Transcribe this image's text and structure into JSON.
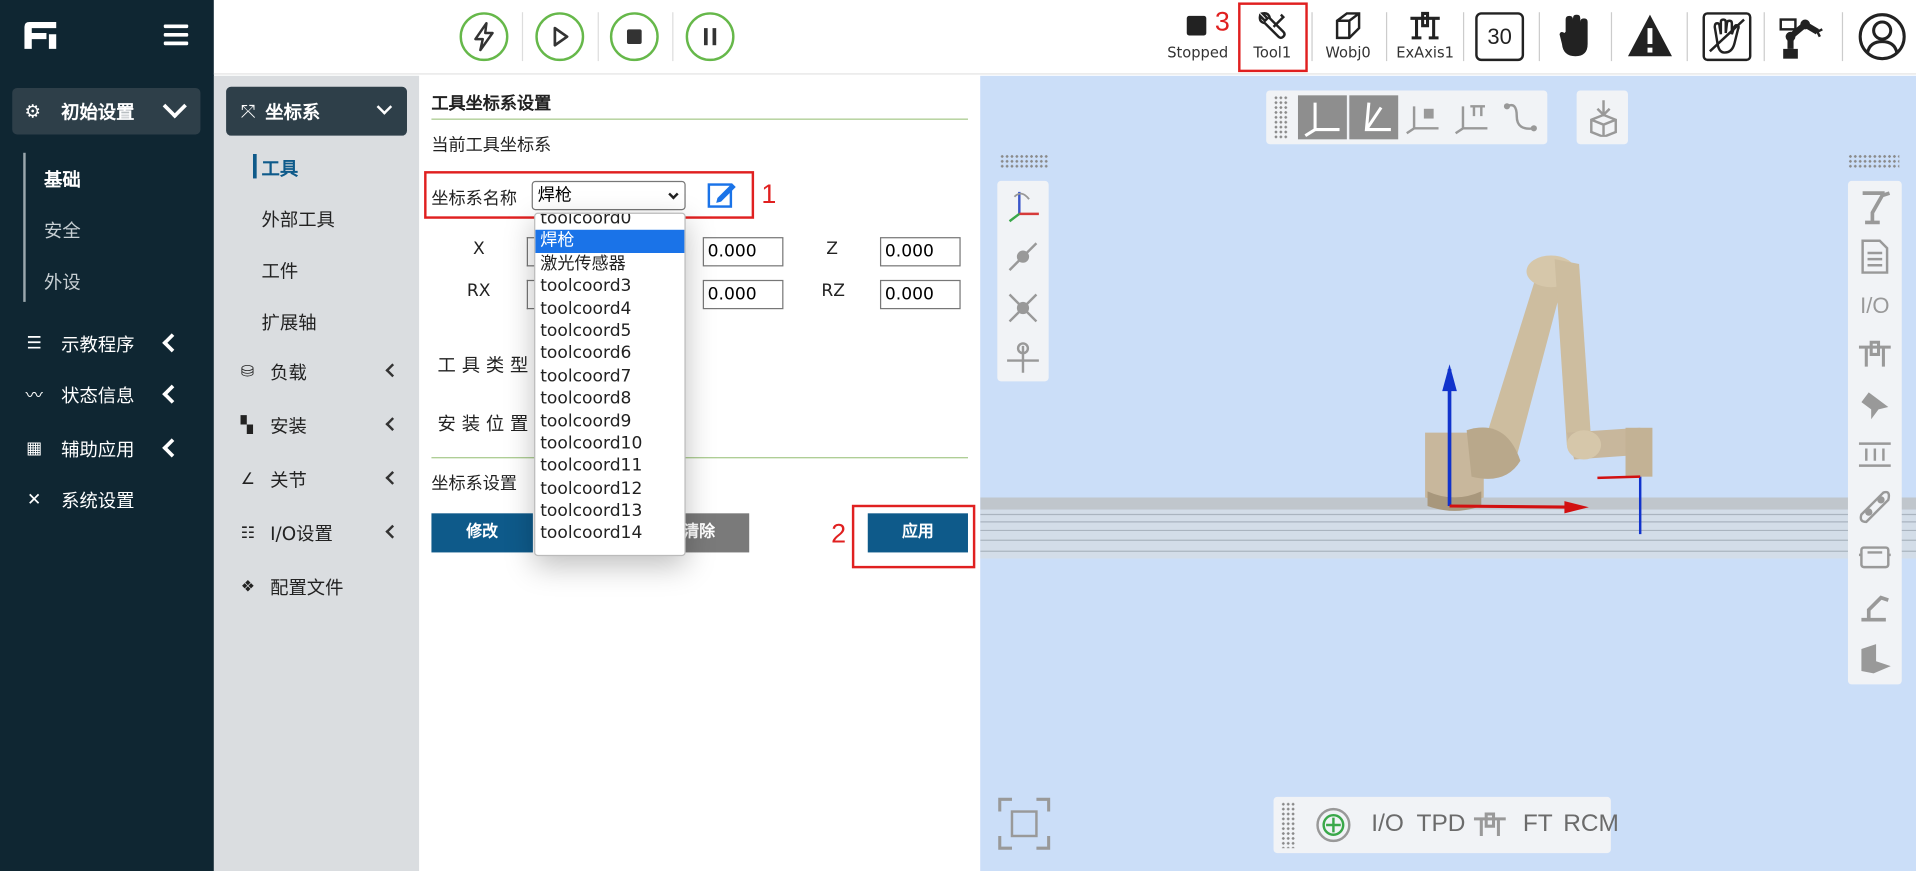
{
  "sidebar": {
    "group_label": "初始设置",
    "sub_items": [
      "基础",
      "安全",
      "外设"
    ],
    "menu": [
      {
        "label": "示教程序",
        "icon": "list-icon"
      },
      {
        "label": "状态信息",
        "icon": "pulse-icon"
      },
      {
        "label": "辅助应用",
        "icon": "grid-icon"
      },
      {
        "label": "系统设置",
        "icon": "tools-icon"
      }
    ]
  },
  "nav2": {
    "head_label": "坐标系",
    "sub_items": [
      "工具",
      "外部工具",
      "工件",
      "扩展轴"
    ],
    "items": [
      {
        "label": "负载",
        "icon": "database-icon"
      },
      {
        "label": "安装",
        "icon": "install-icon"
      },
      {
        "label": "关节",
        "icon": "angle-icon"
      },
      {
        "label": "I/O设置",
        "icon": "sliders-icon"
      },
      {
        "label": "配置文件",
        "icon": "file-icon"
      }
    ]
  },
  "topbar": {
    "status_label": "Stopped",
    "tool_label": "Tool1",
    "wobj_label": "Wobj0",
    "exaxis_label": "ExAxis1",
    "speed_value": "30"
  },
  "annotations": {
    "one": "1",
    "two": "2",
    "three": "3"
  },
  "form": {
    "title": "工具坐标系设置",
    "current_label": "当前工具坐标系",
    "name_label": "坐标系名称",
    "selected_value": "焊枪",
    "x_label": "X",
    "z_label": "Z",
    "rx_label": "RX",
    "rz_label": "RZ",
    "y_value": "0.000",
    "z_value": "0.000",
    "ry_value": "0.000",
    "rz_value": "0.000",
    "tool_type_label": "工 具 类 型",
    "install_pos_label": "安 装 位 置",
    "settings_label": "坐标系设置",
    "modify_button": "修改",
    "clear_button": "清除",
    "apply_button": "应用"
  },
  "dropdown": {
    "options": [
      "toolcoord0",
      "焊枪",
      "激光传感器",
      "toolcoord3",
      "toolcoord4",
      "toolcoord5",
      "toolcoord6",
      "toolcoord7",
      "toolcoord8",
      "toolcoord9",
      "toolcoord10",
      "toolcoord11",
      "toolcoord12",
      "toolcoord13",
      "toolcoord14"
    ],
    "selected_index": 1
  },
  "viewer": {
    "bottom_labels": [
      "I/O",
      "TPD",
      "FT",
      "RCM"
    ],
    "right_io_label": "I/O"
  }
}
